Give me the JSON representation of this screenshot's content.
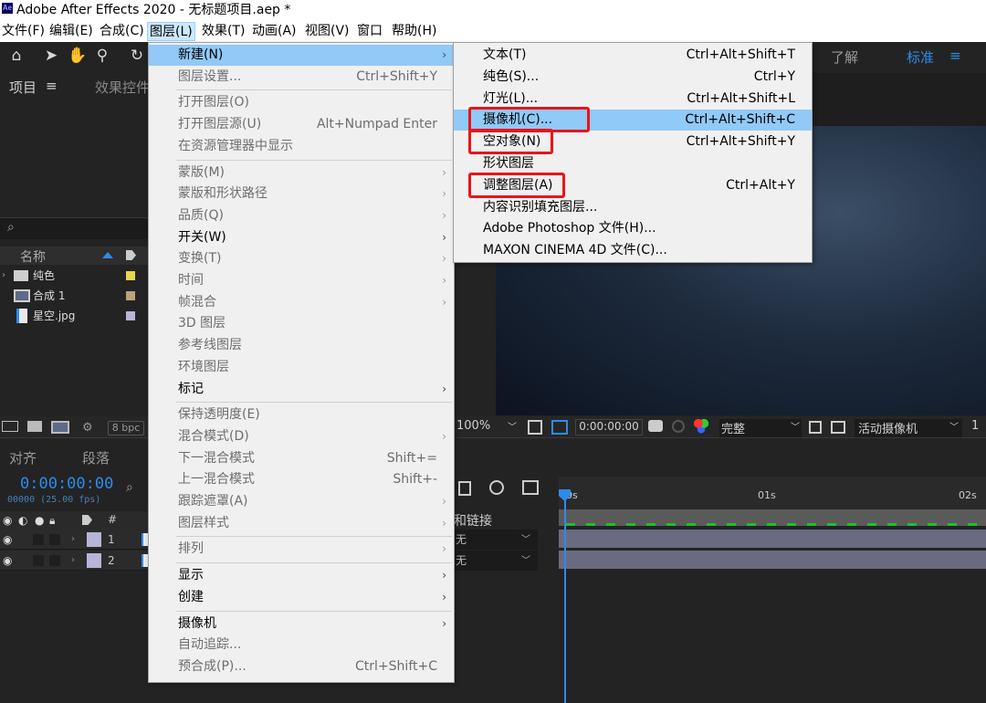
{
  "app": {
    "title": "Adobe After Effects 2020 - 无标题项目.aep *",
    "logo_text": "Ae"
  },
  "menubar": [
    "文件(F)",
    "编辑(E)",
    "合成(C)",
    "图层(L)",
    "效果(T)",
    "动画(A)",
    "视图(V)",
    "窗口",
    "帮助(H)"
  ],
  "workspace": {
    "learn": "了解",
    "standard": "标准",
    "menu_glyph": "≡"
  },
  "panels": {
    "project_tab": "项目",
    "project_tab_glyph": "≡",
    "effects_tab": "效果控件",
    "name_col": "名称",
    "align_tab": "对齐",
    "paragraph_tab": "段落",
    "bpc": "8 bpc",
    "search_glyph": "⌕"
  },
  "project_items": [
    {
      "name": "纯色",
      "color": "#e8d44d",
      "icon": "folder-icon"
    },
    {
      "name": "合成 1",
      "color": "#b8a37a",
      "icon": "composition-icon"
    },
    {
      "name": "星空.jpg",
      "color": "#b7b5d8",
      "icon": "image-file-icon"
    }
  ],
  "viewer_bar": {
    "zoom": "100%",
    "timecode": "0:00:00:00",
    "quality": "完整",
    "camera": "活动摄像机",
    "views": "1"
  },
  "timeline": {
    "timecode": "0:00:00:00",
    "frames": "00000 (25.00 fps)",
    "hash": "#",
    "parent_col": "和链接",
    "parent_value": "无",
    "ruler_labels": [
      "0s",
      "01s",
      "02s"
    ],
    "layers": [
      {
        "num": "1",
        "color": "#b7b5d8"
      },
      {
        "num": "2",
        "color": "#b7b5d8"
      }
    ]
  },
  "layer_menu": [
    {
      "label": "新建(N)",
      "shortcut": "",
      "submenu": true,
      "disabled": false,
      "highlight": true
    },
    {
      "label": "图层设置...",
      "shortcut": "Ctrl+Shift+Y",
      "submenu": false,
      "disabled": true
    },
    {
      "sep": true
    },
    {
      "label": "打开图层(O)",
      "shortcut": "",
      "submenu": false,
      "disabled": true
    },
    {
      "label": "打开图层源(U)",
      "shortcut": "Alt+Numpad Enter",
      "submenu": false,
      "disabled": true
    },
    {
      "label": "在资源管理器中显示",
      "shortcut": "",
      "submenu": false,
      "disabled": true
    },
    {
      "sep": true
    },
    {
      "label": "蒙版(M)",
      "shortcut": "",
      "submenu": true,
      "disabled": true
    },
    {
      "label": "蒙版和形状路径",
      "shortcut": "",
      "submenu": true,
      "disabled": true
    },
    {
      "label": "品质(Q)",
      "shortcut": "",
      "submenu": true,
      "disabled": true
    },
    {
      "label": "开关(W)",
      "shortcut": "",
      "submenu": true,
      "disabled": false
    },
    {
      "label": "变换(T)",
      "shortcut": "",
      "submenu": true,
      "disabled": true
    },
    {
      "label": "时间",
      "shortcut": "",
      "submenu": true,
      "disabled": true
    },
    {
      "label": "帧混合",
      "shortcut": "",
      "submenu": true,
      "disabled": true
    },
    {
      "label": "3D 图层",
      "shortcut": "",
      "submenu": false,
      "disabled": true
    },
    {
      "label": "参考线图层",
      "shortcut": "",
      "submenu": false,
      "disabled": true
    },
    {
      "label": "环境图层",
      "shortcut": "",
      "submenu": false,
      "disabled": true
    },
    {
      "label": "标记",
      "shortcut": "",
      "submenu": true,
      "disabled": false
    },
    {
      "sep": true
    },
    {
      "label": "保持透明度(E)",
      "shortcut": "",
      "submenu": false,
      "disabled": true
    },
    {
      "label": "混合模式(D)",
      "shortcut": "",
      "submenu": true,
      "disabled": true
    },
    {
      "label": "下一混合模式",
      "shortcut": "Shift+=",
      "submenu": false,
      "disabled": true
    },
    {
      "label": "上一混合模式",
      "shortcut": "Shift+-",
      "submenu": false,
      "disabled": true
    },
    {
      "label": "跟踪遮罩(A)",
      "shortcut": "",
      "submenu": true,
      "disabled": true
    },
    {
      "label": "图层样式",
      "shortcut": "",
      "submenu": true,
      "disabled": true
    },
    {
      "sep": true
    },
    {
      "label": "排列",
      "shortcut": "",
      "submenu": true,
      "disabled": true
    },
    {
      "sep": true
    },
    {
      "label": "显示",
      "shortcut": "",
      "submenu": true,
      "disabled": false
    },
    {
      "label": "创建",
      "shortcut": "",
      "submenu": true,
      "disabled": false
    },
    {
      "sep": true
    },
    {
      "label": "摄像机",
      "shortcut": "",
      "submenu": true,
      "disabled": false
    },
    {
      "label": "自动追踪...",
      "shortcut": "",
      "submenu": false,
      "disabled": true
    },
    {
      "label": "预合成(P)...",
      "shortcut": "Ctrl+Shift+C",
      "submenu": false,
      "disabled": true
    }
  ],
  "new_submenu": [
    {
      "label": "文本(T)",
      "shortcut": "Ctrl+Alt+Shift+T",
      "marked": false,
      "highlight": false
    },
    {
      "label": "纯色(S)...",
      "shortcut": "Ctrl+Y",
      "marked": false,
      "highlight": false
    },
    {
      "label": "灯光(L)...",
      "shortcut": "Ctrl+Alt+Shift+L",
      "marked": false,
      "highlight": false
    },
    {
      "label": "摄像机(C)...",
      "shortcut": "Ctrl+Alt+Shift+C",
      "marked": true,
      "highlight": true
    },
    {
      "label": "空对象(N)",
      "shortcut": "Ctrl+Alt+Shift+Y",
      "marked": true,
      "highlight": false
    },
    {
      "label": "形状图层",
      "shortcut": "",
      "marked": false,
      "highlight": false
    },
    {
      "label": "调整图层(A)",
      "shortcut": "Ctrl+Alt+Y",
      "marked": true,
      "highlight": false
    },
    {
      "label": "内容识别填充图层...",
      "shortcut": "",
      "marked": false,
      "highlight": false
    },
    {
      "label": "Adobe Photoshop 文件(H)...",
      "shortcut": "",
      "marked": false,
      "highlight": false
    },
    {
      "label": "MAXON CINEMA 4D 文件(C)...",
      "shortcut": "",
      "marked": false,
      "highlight": false
    }
  ]
}
